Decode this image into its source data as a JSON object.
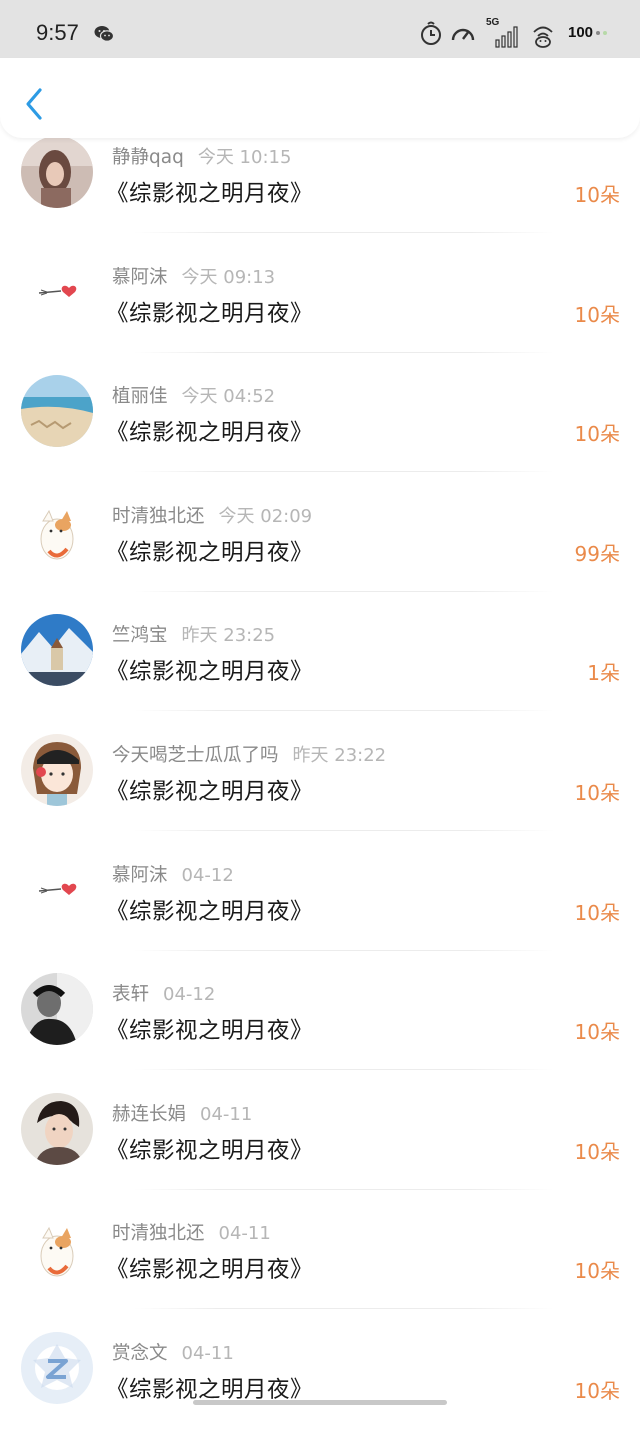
{
  "status_bar": {
    "time": "9:57",
    "signal_label": "5G",
    "battery": "100",
    "icons": [
      "wechat-icon",
      "alarm-icon",
      "speed-icon",
      "signal-icon",
      "wifi-icon",
      "cat-icon"
    ]
  },
  "nav": {
    "back_icon": "chevron-left-icon",
    "accent": "#2d9be4"
  },
  "colors": {
    "amount": "#ea8a4a",
    "name": "#8a8a8a",
    "time": "#b6b6b6"
  },
  "gifts": [
    {
      "name": "静静qaq",
      "time": "今天 10:15",
      "book": "《综影视之明月夜》",
      "amount": "10朵",
      "avatar": "photo-avatar"
    },
    {
      "name": "慕阿沫",
      "time": "今天 09:13",
      "book": "《综影视之明月夜》",
      "amount": "10朵",
      "avatar": "heart-arrow-avatar"
    },
    {
      "name": "植丽佳",
      "time": "今天 04:52",
      "book": "《综影视之明月夜》",
      "amount": "10朵",
      "avatar": "beach-avatar"
    },
    {
      "name": "时清独北还",
      "time": "今天 02:09",
      "book": "《综影视之明月夜》",
      "amount": "99朵",
      "avatar": "cat-avatar"
    },
    {
      "name": "竺鸿宝",
      "time": "昨天 23:25",
      "book": "《综影视之明月夜》",
      "amount": "1朵",
      "avatar": "snow-church-avatar"
    },
    {
      "name": "今天喝芝士瓜瓜了吗",
      "time": "昨天 23:22",
      "book": "《综影视之明月夜》",
      "amount": "10朵",
      "avatar": "cartoon-girl-avatar"
    },
    {
      "name": "慕阿沫",
      "time": "04-12",
      "book": "《综影视之明月夜》",
      "amount": "10朵",
      "avatar": "heart-arrow-avatar"
    },
    {
      "name": "表轩",
      "time": "04-12",
      "book": "《综影视之明月夜》",
      "amount": "10朵",
      "avatar": "bw-photo-avatar"
    },
    {
      "name": "赫连长娟",
      "time": "04-11",
      "book": "《综影视之明月夜》",
      "amount": "10朵",
      "avatar": "portrait-avatar"
    },
    {
      "name": "时清独北还",
      "time": "04-11",
      "book": "《综影视之明月夜》",
      "amount": "10朵",
      "avatar": "cat-avatar"
    },
    {
      "name": "赏念文",
      "time": "04-11",
      "book": "《综影视之明月夜》",
      "amount": "10朵",
      "avatar": "default-z-avatar"
    }
  ]
}
